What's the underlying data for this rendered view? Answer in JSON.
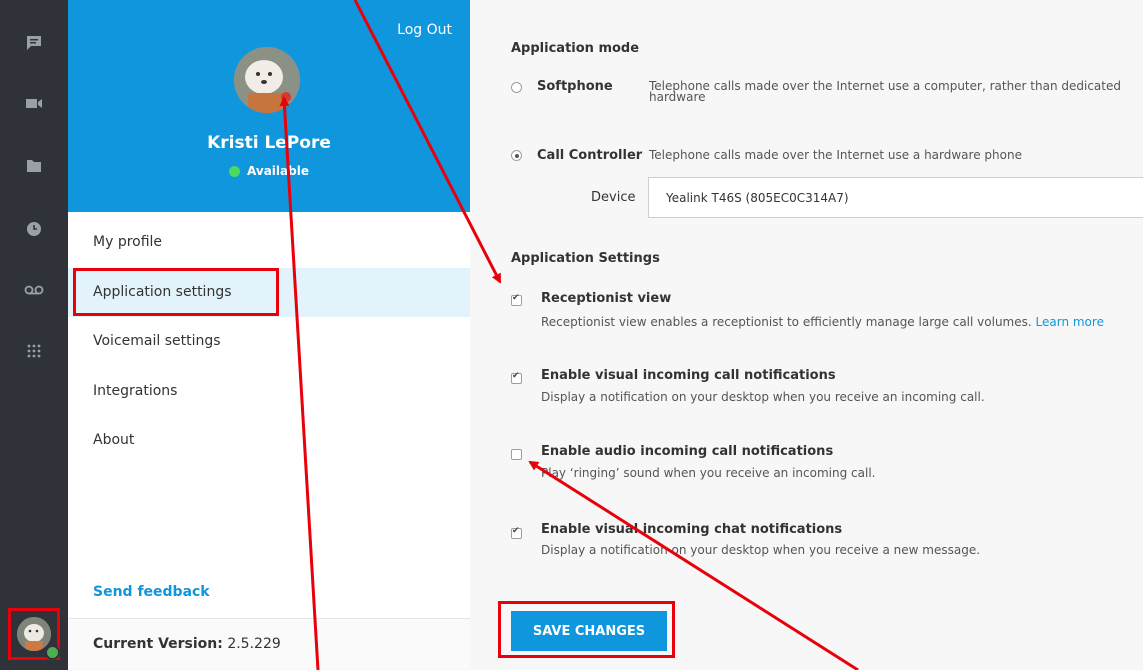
{
  "colors": {
    "rail_bg": "#2f3339",
    "brand_blue": "#0f96dd",
    "status_green": "#4cd964",
    "annotation_red": "#e8000b"
  },
  "rail": {
    "icons": [
      "chat-icon",
      "video-icon",
      "folder-icon",
      "clock-icon",
      "voicemail-icon",
      "dialpad-icon"
    ]
  },
  "profile": {
    "logout_label": "Log Out",
    "name": "Kristi LePore",
    "status": "Available"
  },
  "nav": {
    "items": [
      {
        "label": "My profile"
      },
      {
        "label": "Application settings"
      },
      {
        "label": "Voicemail settings"
      },
      {
        "label": "Integrations"
      },
      {
        "label": "About"
      }
    ],
    "feedback_label": "Send feedback",
    "version_label": "Current Version:",
    "version_value": "2.5.229"
  },
  "main": {
    "mode_title": "Application mode",
    "modes": [
      {
        "label": "Softphone",
        "desc": "Telephone calls made over the Internet use a computer, rather than dedicated hardware",
        "selected": false
      },
      {
        "label": "Call Controller",
        "desc": "Telephone calls made over the Internet use a hardware phone",
        "selected": true
      }
    ],
    "device_label": "Device",
    "device_value": "Yealink T46S (805EC0C314A7)",
    "settings_title": "Application Settings",
    "options": [
      {
        "title": "Receptionist view",
        "desc": "Receptionist view enables a receptionist to efficiently manage large call volumes.",
        "link": "Learn more",
        "checked": true
      },
      {
        "title": "Enable visual incoming call notifications",
        "desc": "Display a notification on your desktop when you receive an incoming call.",
        "checked": true
      },
      {
        "title": "Enable audio incoming call notifications",
        "desc": "Play ‘ringing’ sound when you receive an incoming call.",
        "checked": false
      },
      {
        "title": "Enable visual incoming chat notifications",
        "desc": "Display a notification on your desktop when you receive a new message.",
        "checked": true
      }
    ],
    "save_label": "SAVE CHANGES"
  }
}
